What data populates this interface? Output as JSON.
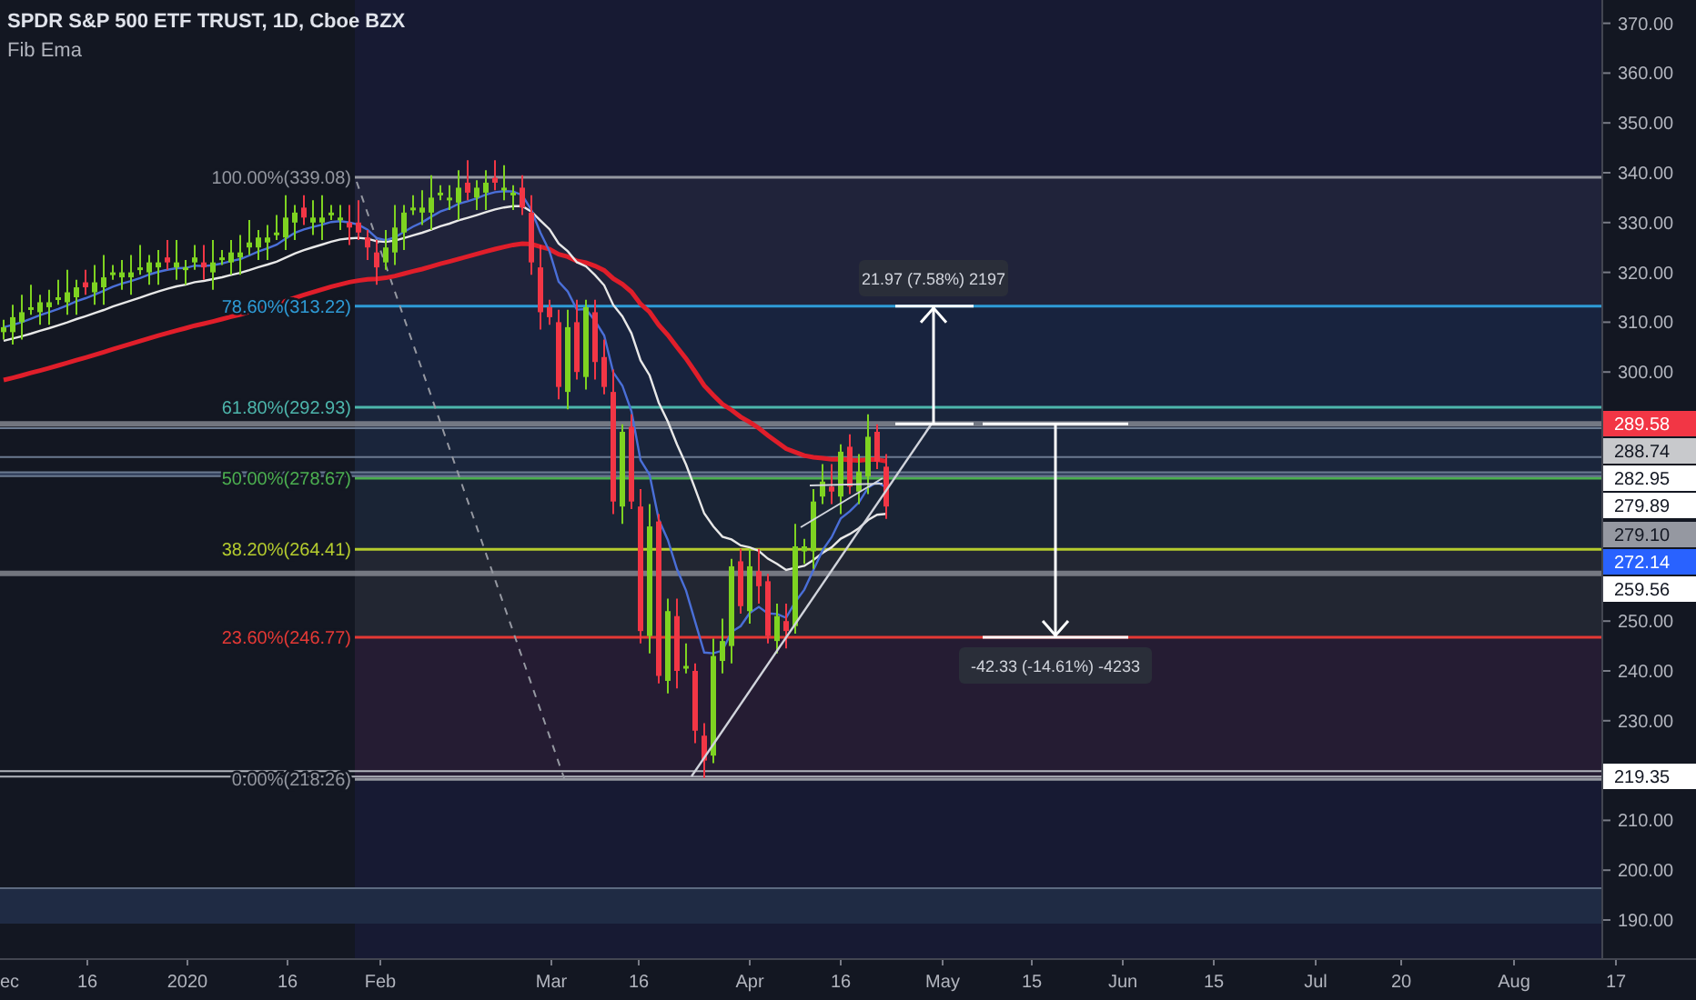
{
  "legend": {
    "symbol": "SPDR S&P 500 ETF TRUST, 1D, Cboe BZX",
    "indicator": "Fib Ema"
  },
  "fib_levels": [
    {
      "label": "100.00%(339.08)",
      "color": "#9598a1"
    },
    {
      "label": "78.60%(313.22)",
      "color": "#2e9bd6"
    },
    {
      "label": "61.80%(292.93)",
      "color": "#4db6ac"
    },
    {
      "label": "50.00%(278.67)",
      "color": "#4caf50"
    },
    {
      "label": "38.20%(264.41)",
      "color": "#b5cc2e"
    },
    {
      "label": "23.60%(246.77)",
      "color": "#e53935"
    },
    {
      "label": "0.00%(218.26)",
      "color": "#9598a1"
    }
  ],
  "measurements": [
    {
      "label": "21.97 (7.58%) 2197"
    },
    {
      "label": "-42.33 (-14.61%) -4233"
    }
  ],
  "price_axis": {
    "ticks": [
      "370.00",
      "360.00",
      "350.00",
      "340.00",
      "330.00",
      "320.00",
      "310.00",
      "300.00",
      "250.00",
      "240.00",
      "230.00",
      "210.00",
      "200.00",
      "190.00"
    ],
    "price_tags": [
      {
        "label": "289.58",
        "color": "#f23645"
      },
      {
        "label": "288.74",
        "color": "#c8c9cc"
      },
      {
        "label": "282.95",
        "color": "#ffffff"
      },
      {
        "label": "279.89",
        "color": "#ffffff"
      },
      {
        "label": "279.10",
        "color": "#9598a1"
      },
      {
        "label": "272.14",
        "color": "#2962ff"
      },
      {
        "label": "259.56",
        "color": "#ffffff"
      },
      {
        "label": "219.35",
        "color": "#ffffff"
      }
    ]
  },
  "time_axis": {
    "ticks": [
      "ec",
      "16",
      "2020",
      "16",
      "Feb",
      "Mar",
      "16",
      "Apr",
      "16",
      "May",
      "15",
      "Jun",
      "15",
      "Jul",
      "20",
      "Aug",
      "17"
    ]
  }
}
